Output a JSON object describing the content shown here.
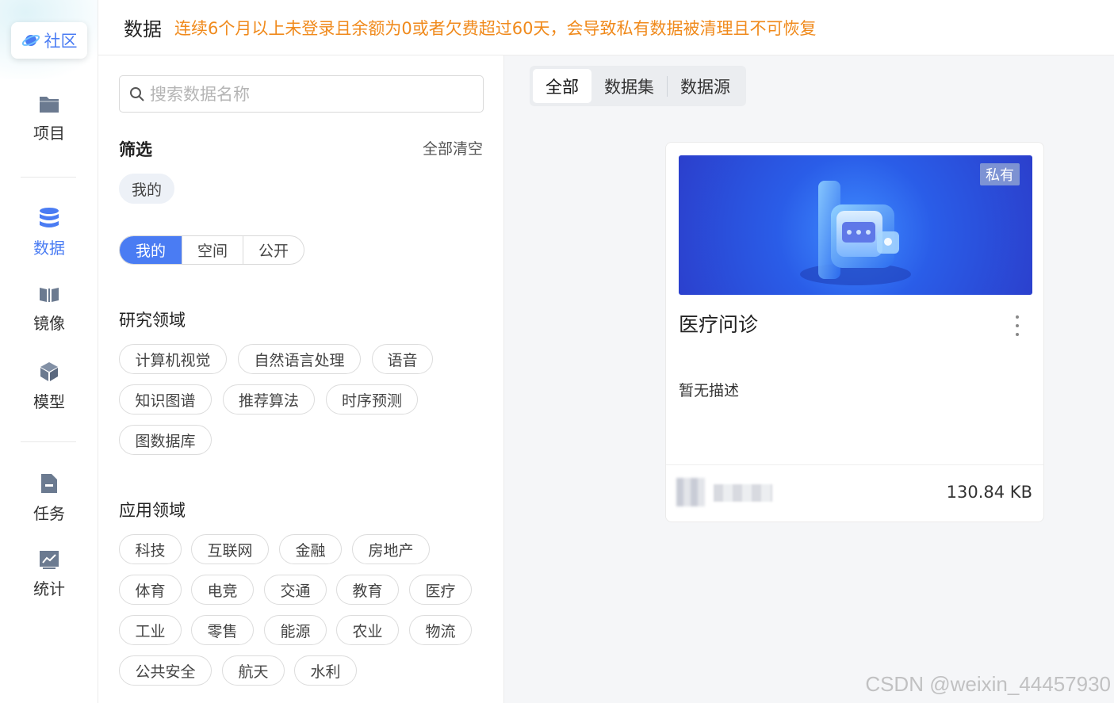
{
  "nav": {
    "community": "社区",
    "items": [
      {
        "label": "项目",
        "icon": "folder-icon",
        "active": false
      },
      {
        "label": "数据",
        "icon": "database-icon",
        "active": true
      },
      {
        "label": "镜像",
        "icon": "mirror-icon",
        "active": false
      },
      {
        "label": "模型",
        "icon": "cube-icon",
        "active": false
      },
      {
        "label": "任务",
        "icon": "task-icon",
        "active": false
      },
      {
        "label": "统计",
        "icon": "chart-icon",
        "active": false
      }
    ]
  },
  "header": {
    "title": "数据",
    "warning": "连续6个月以上未登录且余额为0或者欠费超过60天，会导致私有数据被清理且不可恢复"
  },
  "filter": {
    "search_placeholder": "搜索数据名称",
    "title": "筛选",
    "clear_all": "全部清空",
    "selected": [
      "我的"
    ],
    "scope": [
      "我的",
      "空间",
      "公开"
    ],
    "scope_selected": "我的",
    "research": {
      "title": "研究领域",
      "items": [
        "计算机视觉",
        "自然语言处理",
        "语音",
        "知识图谱",
        "推荐算法",
        "时序预测",
        "图数据库"
      ]
    },
    "application": {
      "title": "应用领域",
      "items": [
        "科技",
        "互联网",
        "金融",
        "房地产",
        "体育",
        "电竞",
        "交通",
        "教育",
        "医疗",
        "工业",
        "零售",
        "能源",
        "农业",
        "物流",
        "公共安全",
        "航天",
        "水利"
      ]
    }
  },
  "tabs": {
    "items": [
      "全部",
      "数据集",
      "数据源"
    ],
    "active": "全部"
  },
  "card": {
    "tag": "私有",
    "title": "医疗问诊",
    "description": "暂无描述",
    "size": "130.84 KB"
  },
  "watermark": "CSDN @weixin_44457930",
  "colors": {
    "accent": "#4a7cf3",
    "warning": "#f08a1c"
  }
}
